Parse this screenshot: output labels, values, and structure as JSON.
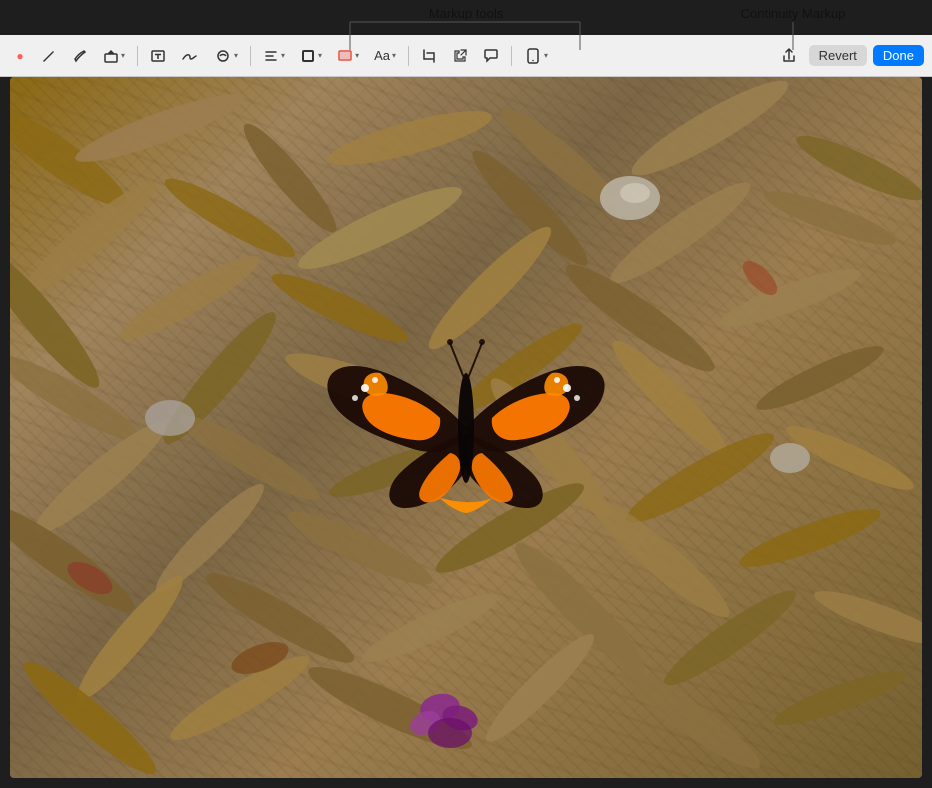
{
  "annotations": {
    "markup_tools_label": "Markup tools",
    "continuity_markup_label": "Continuity Markup"
  },
  "toolbar": {
    "tools": [
      {
        "name": "close-traffic-lights",
        "icon": "●",
        "label": "window controls"
      },
      {
        "name": "pen-tool",
        "icon": "✒",
        "label": "Pen"
      },
      {
        "name": "marker-tool",
        "icon": "〜",
        "label": "Marker"
      },
      {
        "name": "shapes-tool",
        "icon": "⧉",
        "label": "Shapes",
        "has_arrow": true
      },
      {
        "name": "text-tool",
        "icon": "A",
        "label": "Text"
      },
      {
        "name": "sign-tool",
        "icon": "✍",
        "label": "Sign"
      },
      {
        "name": "annotation-tool",
        "icon": "📍",
        "label": "Annotation",
        "has_arrow": true
      },
      {
        "name": "align-tool",
        "icon": "≡",
        "label": "Align",
        "has_arrow": true
      },
      {
        "name": "border-tool",
        "icon": "□",
        "label": "Border",
        "has_arrow": true
      },
      {
        "name": "color-tool",
        "icon": "◫",
        "label": "Color",
        "has_arrow": true
      },
      {
        "name": "font-tool",
        "icon": "Aa",
        "label": "Font",
        "has_arrow": true
      },
      {
        "name": "crop-tool",
        "icon": "⬚",
        "label": "Crop"
      },
      {
        "name": "resize-tool",
        "icon": "⤢",
        "label": "Resize"
      },
      {
        "name": "speech-bubble-tool",
        "icon": "💬",
        "label": "Speech Bubble"
      },
      {
        "name": "continuity-tool",
        "icon": "📱",
        "label": "Continuity",
        "has_arrow": true
      }
    ],
    "revert_label": "Revert",
    "done_label": "Done"
  },
  "image": {
    "alt": "Butterfly on wood chips"
  }
}
